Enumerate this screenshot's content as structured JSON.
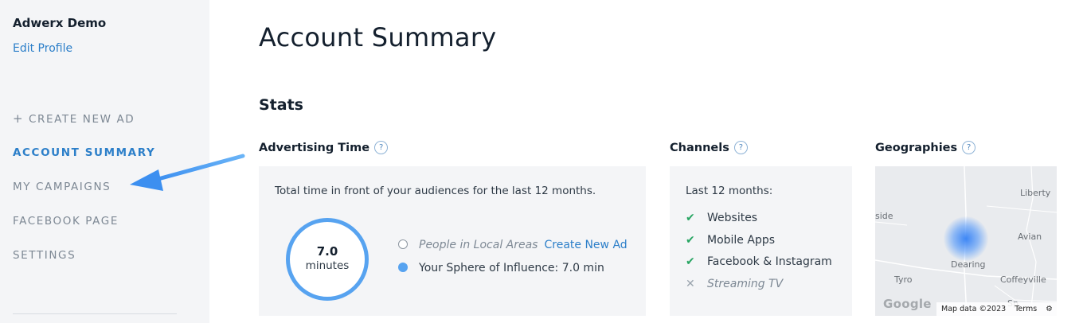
{
  "sidebar": {
    "profile_name": "Adwerx Demo",
    "edit_profile": "Edit Profile",
    "nav": [
      {
        "label": "CREATE NEW AD",
        "icon": "+"
      },
      {
        "label": "ACCOUNT SUMMARY",
        "active": true
      },
      {
        "label": "MY CAMPAIGNS"
      },
      {
        "label": "FACEBOOK PAGE"
      },
      {
        "label": "SETTINGS"
      }
    ]
  },
  "main": {
    "title": "Account Summary",
    "stats_heading": "Stats",
    "advertising_time": {
      "title": "Advertising Time",
      "help": "?",
      "description": "Total time in front of your audiences for the last 12 months.",
      "ring_value": "7.0",
      "ring_unit": "minutes",
      "legend": [
        {
          "label": "People in Local Areas",
          "link": "Create New Ad"
        },
        {
          "label": "Your Sphere of Influence: 7.0 min"
        }
      ]
    },
    "channels": {
      "title": "Channels",
      "help": "?",
      "intro": "Last 12 months:",
      "items": [
        {
          "mark": "✔",
          "label": "Websites"
        },
        {
          "mark": "✔",
          "label": "Mobile Apps"
        },
        {
          "mark": "✔",
          "label": "Facebook & Instagram"
        },
        {
          "mark": "✕",
          "label": "Streaming TV"
        }
      ]
    },
    "geographies": {
      "title": "Geographies",
      "help": "?",
      "map_labels": [
        "Liberty",
        "side",
        "Avian",
        "Dearing",
        "Tyro",
        "Coffeyville",
        "Sp"
      ],
      "google": "Google",
      "map_data": "Map data ©2023",
      "terms": "Terms"
    }
  },
  "colors": {
    "accent": "#2c7fc9",
    "ring": "#57a3f0",
    "check": "#27a562",
    "sidebar_bg": "#f4f5f7"
  }
}
